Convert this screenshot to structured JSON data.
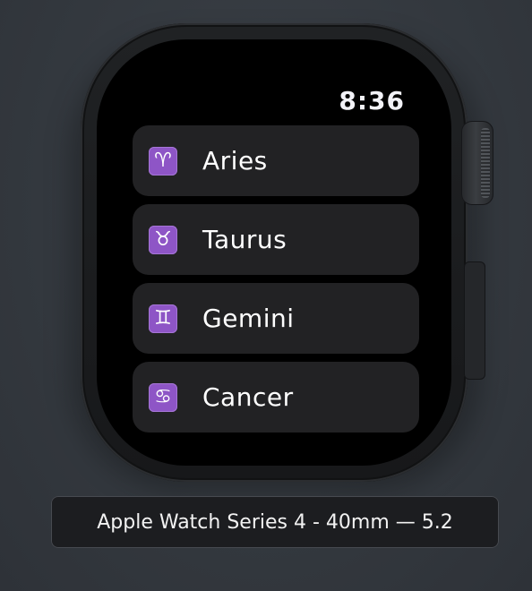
{
  "status": {
    "time": "8:36"
  },
  "zodiac": {
    "items": [
      {
        "symbol": "♈",
        "label": "Aries",
        "icon": "aries-icon"
      },
      {
        "symbol": "♉",
        "label": "Taurus",
        "icon": "taurus-icon"
      },
      {
        "symbol": "♊",
        "label": "Gemini",
        "icon": "gemini-icon"
      },
      {
        "symbol": "♋",
        "label": "Cancer",
        "icon": "cancer-icon"
      }
    ]
  },
  "device": {
    "caption": "Apple Watch Series 4 - 40mm — 5.2"
  },
  "colors": {
    "sign_badge": "#8e55c6",
    "row_background": "#222224",
    "screen_background": "#000000"
  }
}
